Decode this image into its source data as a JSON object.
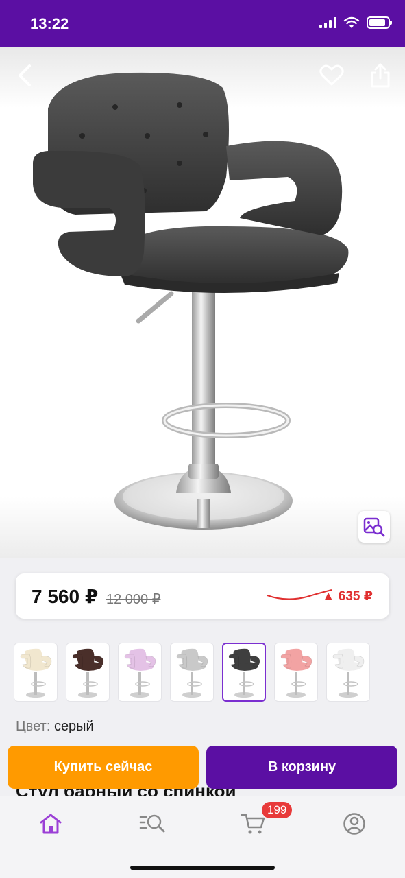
{
  "status": {
    "time": "13:22",
    "battery_level": 0.9
  },
  "product": {
    "price": "7 560 ₽",
    "old_price": "12 000 ₽",
    "price_change": "635 ₽",
    "price_change_color": "#e03030",
    "color_key": "Цвет:",
    "color_value": "серый",
    "title_peek": "Стул барный со спинкой"
  },
  "variants": [
    {
      "name": "cream",
      "color": "#f1e7cf"
    },
    {
      "name": "brown",
      "color": "#4a2f2a"
    },
    {
      "name": "lilac",
      "color": "#e4c2e6"
    },
    {
      "name": "light-grey",
      "color": "#c9c9c9"
    },
    {
      "name": "grey",
      "color": "#3f3f3f",
      "selected": true
    },
    {
      "name": "pink",
      "color": "#f2a3a3"
    },
    {
      "name": "white",
      "color": "#efefef"
    }
  ],
  "actions": {
    "buy_now": "Купить сейчас",
    "add_to_cart": "В корзину"
  },
  "tabbar": {
    "cart_badge": "199"
  },
  "colors": {
    "brand": "#5b0fa3",
    "accent": "#ff9a00",
    "tab_active": "#9b3fd6"
  },
  "icons": [
    "back-icon",
    "heart-icon",
    "share-icon",
    "image-search-icon",
    "home-icon",
    "catalog-search-icon",
    "cart-icon",
    "profile-icon"
  ]
}
